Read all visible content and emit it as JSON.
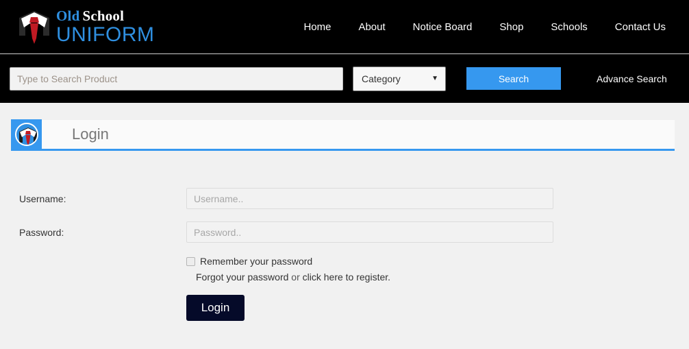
{
  "header": {
    "brand": {
      "line1_part1": "Old",
      "line1_part2": "School",
      "line2": "UNIFORM",
      "logo_icon": "shirt-collar-tie-logo"
    },
    "nav": [
      {
        "label": "Home"
      },
      {
        "label": "About"
      },
      {
        "label": "Notice Board"
      },
      {
        "label": "Shop"
      },
      {
        "label": "Schools"
      },
      {
        "label": "Contact Us"
      }
    ]
  },
  "search": {
    "placeholder": "Type to Search Product",
    "value": "",
    "category_label": "Category",
    "category_caret_icon": "chevron-down-icon",
    "search_button": "Search",
    "advance_search": "Advance Search"
  },
  "panel": {
    "icon": "shirt-collar-tie-circle-icon",
    "title": "Login"
  },
  "form": {
    "username_label": "Username:",
    "username_placeholder": "Username..",
    "username_value": "",
    "password_label": "Password:",
    "password_placeholder": "Password..",
    "password_value": "",
    "remember_label": "Remember your password",
    "remember_checked": false,
    "forgot_link": "Forgot your password",
    "links_separator": " or ",
    "register_link": "click here to register.",
    "login_button": "Login"
  },
  "colors": {
    "accent_blue": "#3698ef",
    "brand_blue": "#2f8fe0",
    "nav_black": "#000000",
    "page_bg": "#f1f1f1",
    "login_button": "#050a29",
    "tie_red": "#c01a23"
  }
}
